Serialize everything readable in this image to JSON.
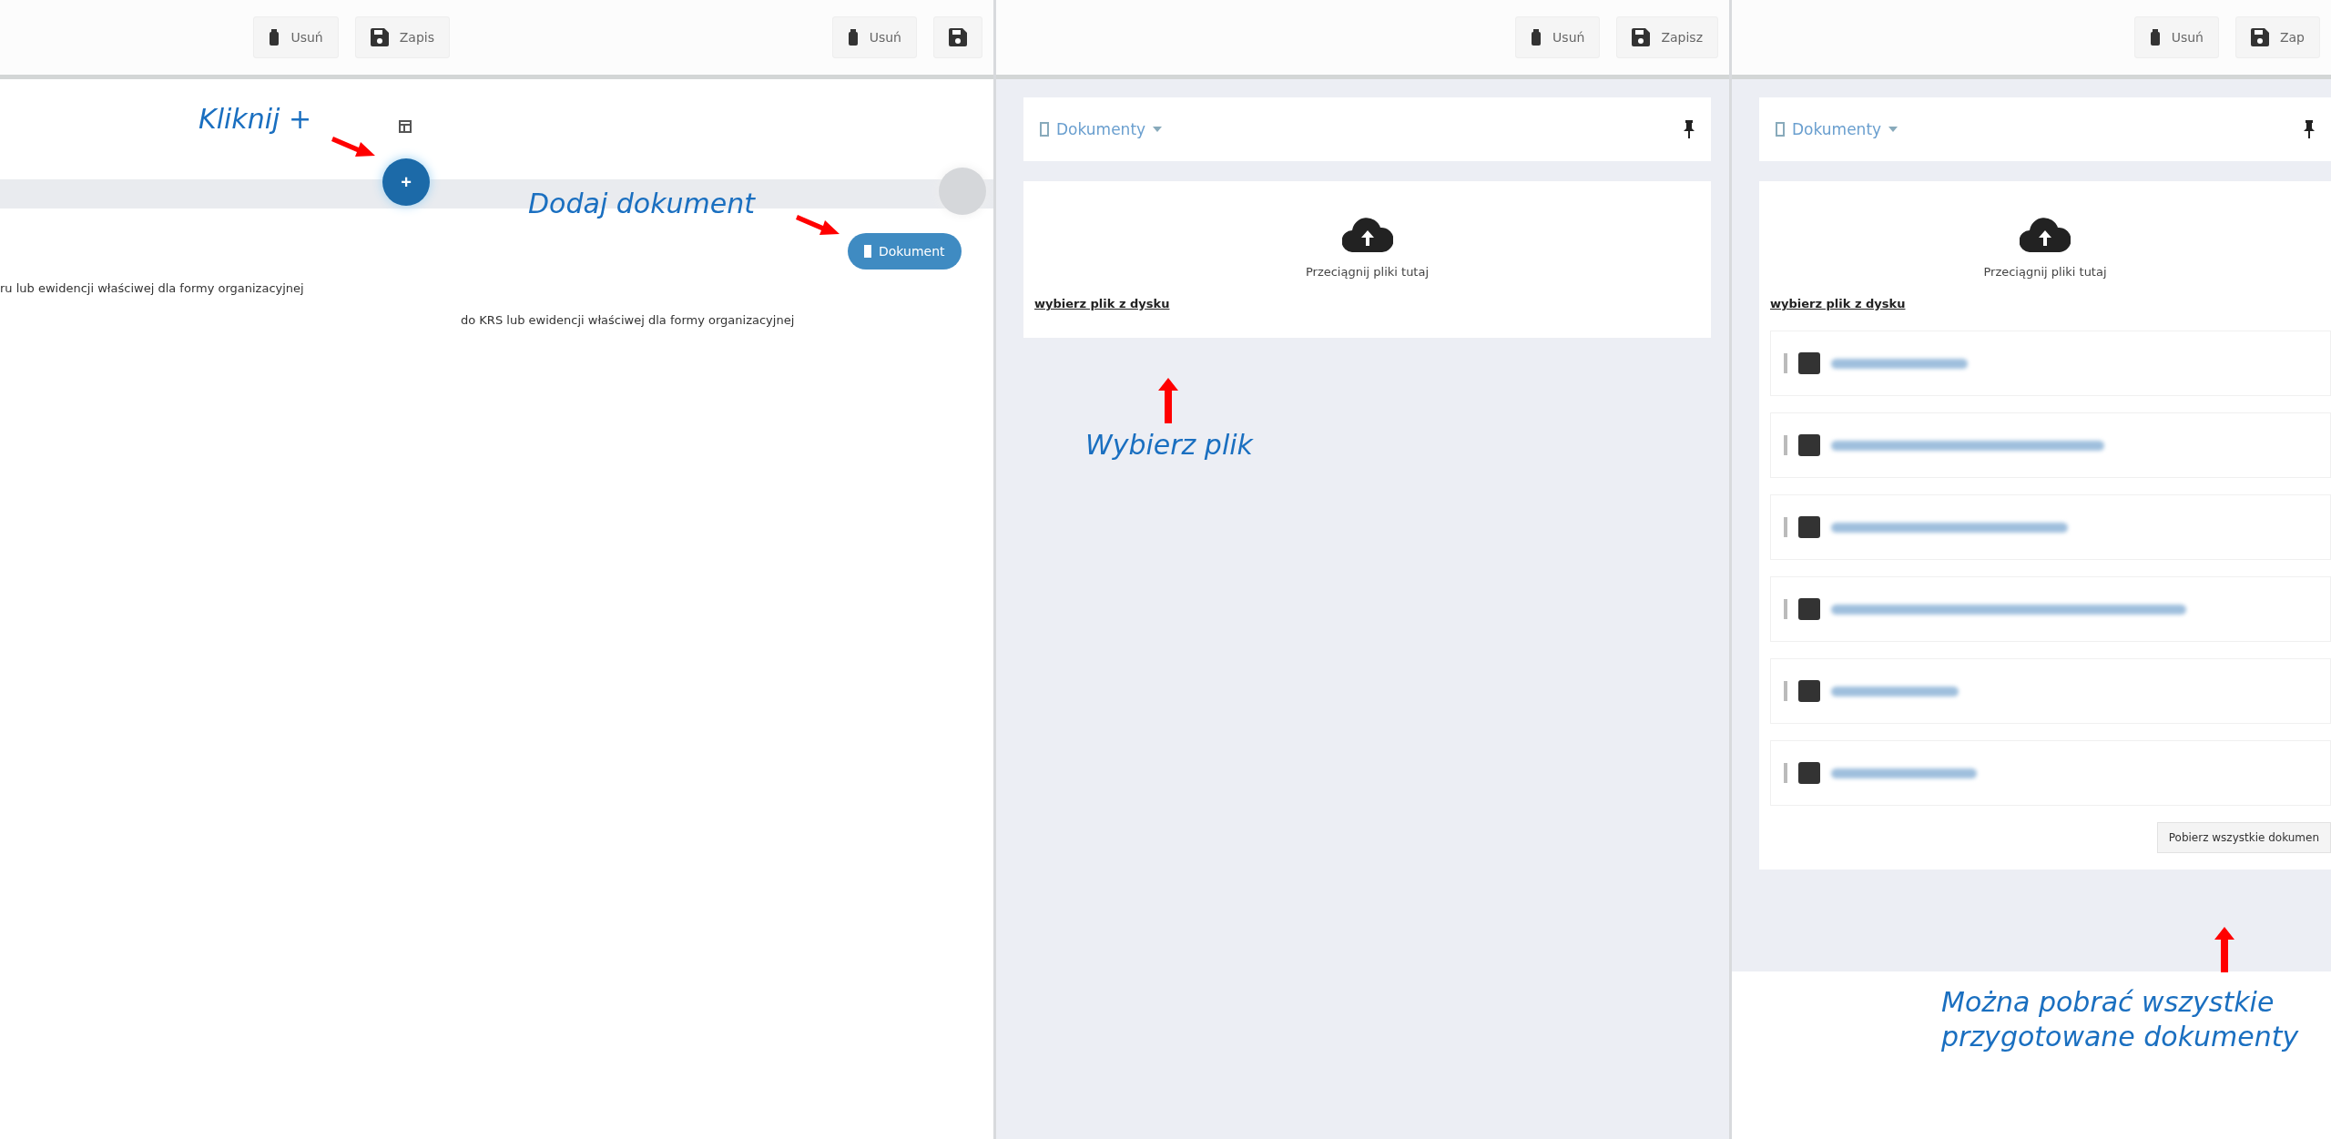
{
  "panels": [
    {
      "kind": "add",
      "toolbar": {
        "delete": "Usuń",
        "save": "Zapis"
      },
      "plus_button": {
        "label": "+",
        "selected": true
      },
      "description": "ru lub ewidencji właściwej dla formy organizacyjnej",
      "annotation": "Kliknij +"
    },
    {
      "kind": "menu",
      "toolbar": {
        "delete": "Usuń"
      },
      "document_button": "Dokument",
      "description": "do KRS lub ewidencji właściwej dla formy organizacyjnej",
      "annotation": "Dodaj dokument"
    },
    {
      "kind": "upload",
      "toolbar": {
        "delete": "Usuń",
        "save": "Zapisz"
      },
      "section_title": "Dokumenty",
      "dropzone": "Przeciągnij pliki tutaj",
      "pick_link": "wybierz plik z dysku",
      "annotation": "Wybierz plik"
    },
    {
      "kind": "list",
      "toolbar": {
        "delete": "Usuń",
        "save": "Zap"
      },
      "section_title": "Dokumenty",
      "dropzone": "Przeciągnij pliki tutaj",
      "pick_link": "wybierz plik z dysku",
      "files": [
        {
          "kind": "pdf"
        },
        {
          "kind": "pdf"
        },
        {
          "kind": "pdf"
        },
        {
          "kind": "pdf"
        },
        {
          "kind": "pdf"
        },
        {
          "kind": "pdf"
        }
      ],
      "download_all": "Pobierz wszystkie dokumen",
      "annotation": [
        "Można pobrać wszystkie",
        "przygotowane dokumenty"
      ]
    }
  ]
}
